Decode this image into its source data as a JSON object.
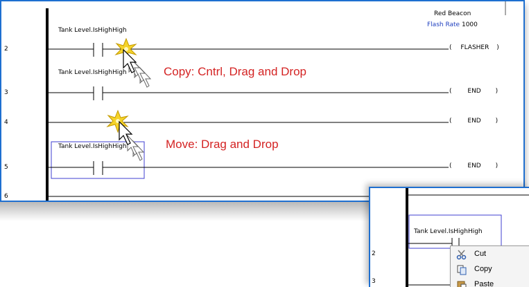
{
  "ladder": {
    "rungs": [
      {
        "num": "2",
        "contact_label": "Tank Level.IsHighHigh",
        "coil": "FLASHER"
      },
      {
        "num": "3",
        "contact_label": "Tank Level.IsHighHigh",
        "coil": "END"
      },
      {
        "num": "4",
        "contact_label": "",
        "coil": "END"
      },
      {
        "num": "5",
        "contact_label": "Tank Level.IsHighHigh",
        "coil": "END"
      },
      {
        "num": "6",
        "contact_label": "",
        "coil": ""
      }
    ],
    "beacon_title": "Red Beacon",
    "flash_rate_label": "Flash Rate",
    "flash_rate_value": "1000",
    "paren_open": "(",
    "paren_close": ")"
  },
  "annotations": {
    "copy_text": "Copy: Cntrl, Drag and Drop",
    "move_text": "Move: Drag and Drop",
    "color": "#d42323"
  },
  "popup": {
    "contact_label": "Tank Level.IsHighHigh",
    "rung_nums": [
      "2",
      "3"
    ],
    "menu": [
      {
        "label": "Cut",
        "icon": "scissors-icon"
      },
      {
        "label": "Copy",
        "icon": "copy-icon"
      },
      {
        "label": "Paste",
        "icon": "paste-icon"
      }
    ]
  },
  "colors": {
    "accent": "#1e6fd0",
    "selection": "#3f3fd0",
    "flash_rate": "#1f3fbf"
  }
}
